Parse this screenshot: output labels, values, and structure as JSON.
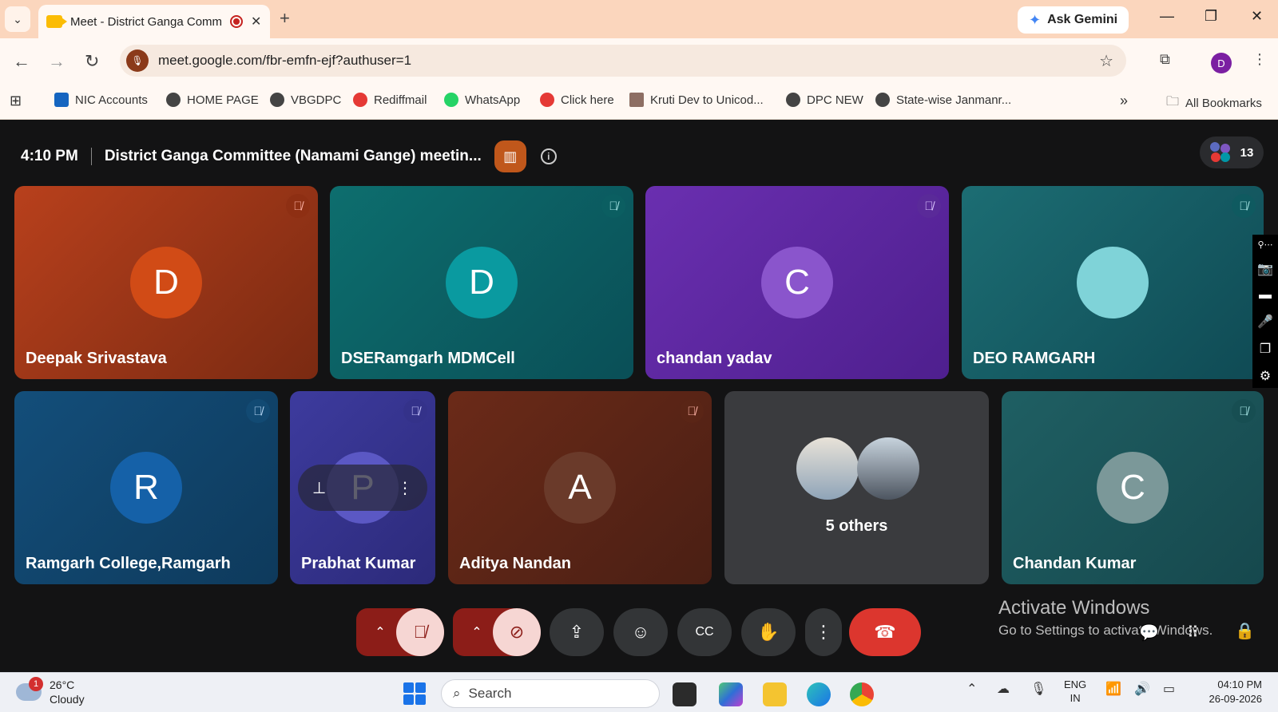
{
  "browser": {
    "tab_title": "Meet - District Ganga Comm",
    "new_tab": "+",
    "ask_gemini": "Ask Gemini",
    "url": "meet.google.com/fbr-emfn-ejf?authuser=1",
    "profile_initial": "D",
    "bookmarks": [
      "NIC Accounts",
      "HOME PAGE",
      "VBGDPC",
      "Rediffmail",
      "WhatsApp",
      "Click here",
      "Kruti Dev to Unicod...",
      "DPC NEW",
      "State-wise Janmanr..."
    ],
    "bookmarks_overflow": "»",
    "all_bookmarks": "All Bookmarks"
  },
  "meeting": {
    "time": "4:10 PM",
    "title": "District Ganga Committee (Namami Gange) meetin...",
    "participant_count": "13"
  },
  "tiles": [
    {
      "name": "Deepak Srivastava",
      "initial": "D",
      "muted": true
    },
    {
      "name": "DSERamgarh MDMCell",
      "initial": "D",
      "muted": true
    },
    {
      "name": "chandan yadav",
      "initial": "C",
      "muted": true
    },
    {
      "name": "DEO RAMGARH",
      "initial": "",
      "muted": true
    },
    {
      "name": "Ramgarh College,Ramgarh",
      "initial": "R",
      "muted": true
    },
    {
      "name": "Prabhat Kumar",
      "initial": "P",
      "muted": true
    },
    {
      "name": "Aditya Nandan",
      "initial": "A",
      "muted": true
    },
    {
      "name": "5 others",
      "initial": "",
      "muted": false
    },
    {
      "name": "Chandan Kumar",
      "initial": "C",
      "muted": true
    }
  ],
  "overlay": {
    "activate_title": "Activate Windows",
    "activate_sub": "Go to Settings to activate Windows."
  },
  "taskbar": {
    "temperature": "26°C",
    "weather": "Cloudy",
    "weather_badge": "1",
    "search_placeholder": "Search",
    "lang_top": "ENG",
    "lang_bottom": "IN",
    "time": "04:10 PM",
    "date": "26-09-2026"
  },
  "colors": {
    "record": "#c5221f",
    "hangup": "#dc362e",
    "muted_ctrl": "#8c1d18"
  }
}
